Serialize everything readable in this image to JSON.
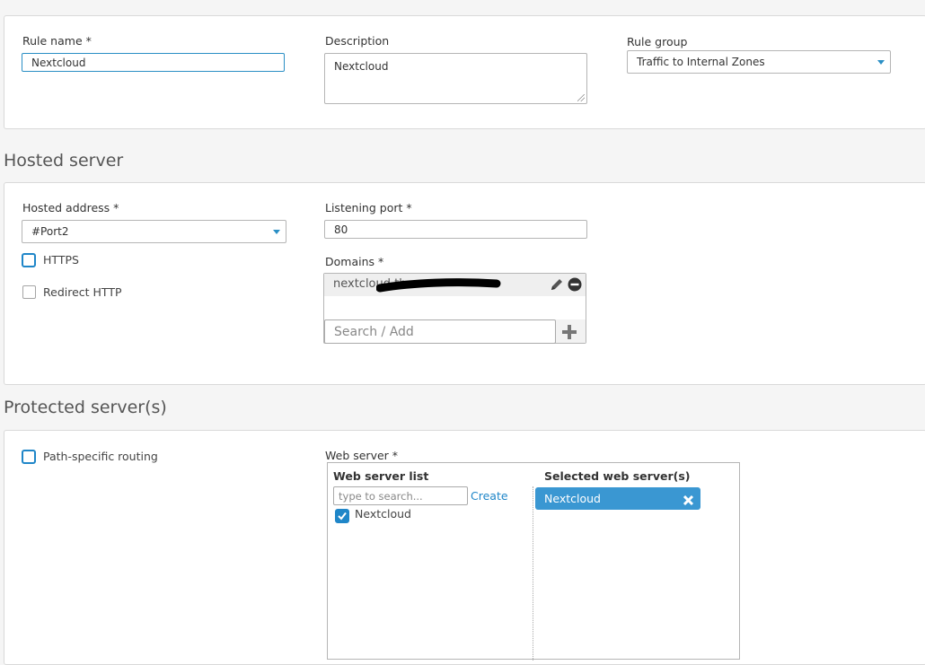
{
  "rule": {
    "name_label": "Rule name *",
    "name_value": "Nextcloud",
    "description_label": "Description",
    "description_value": "Nextcloud",
    "group_label": "Rule group",
    "group_value": "Traffic to Internal Zones"
  },
  "hosted": {
    "section_title": "Hosted server",
    "address_label": "Hosted address *",
    "address_value": "#Port2",
    "https_label": "HTTPS",
    "redirect_label": "Redirect HTTP",
    "port_label": "Listening port *",
    "port_value": "80",
    "domains_label": "Domains *",
    "domain_item": "nextcloud.the",
    "domain_search_placeholder": "Search / Add"
  },
  "protected": {
    "section_title": "Protected server(s)",
    "path_routing_label": "Path-specific routing",
    "web_server_label": "Web server *",
    "list_header": "Web server list",
    "search_placeholder": "type to search...",
    "create_link": "Create",
    "list_items": [
      {
        "label": "Nextcloud",
        "checked": true
      }
    ],
    "selected_header": "Selected web server(s)",
    "selected_items": [
      "Nextcloud"
    ]
  },
  "colors": {
    "accent": "#1f86c8",
    "chip": "#3a97d2",
    "focus_border": "#2a8fc5"
  }
}
